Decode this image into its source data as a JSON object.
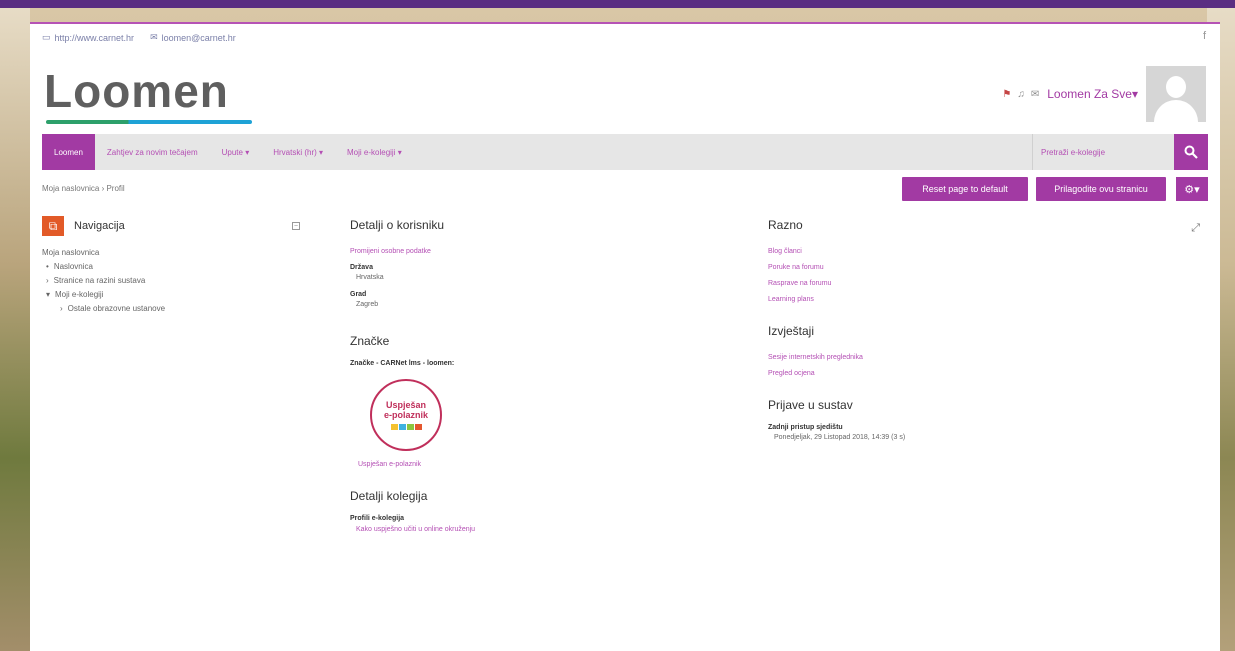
{
  "header": {
    "url": "http://www.carnet.hr",
    "email": "loomen@carnet.hr",
    "social": "f",
    "logo": "Loomen",
    "username": "Loomen Za Sve",
    "username_caret": "▾"
  },
  "nav": {
    "items": [
      {
        "label": "Loomen",
        "active": true
      },
      {
        "label": "Zahtjev za novim tečajem"
      },
      {
        "label": "Upute ▾"
      },
      {
        "label": "Hrvatski (hr) ▾"
      },
      {
        "label": "Moji e-kolegiji ▾"
      }
    ],
    "search_placeholder": "Pretraži e-kolegije",
    "search_icon": "search-icon"
  },
  "breadcrumb": "Moja naslovnica › Profil",
  "buttons": {
    "reset": "Reset page to default",
    "customize": "Prilagodite ovu stranicu"
  },
  "navigation_block": {
    "title": "Navigacija",
    "items": [
      {
        "label": "Moja naslovnica",
        "prefix": ""
      },
      {
        "label": "Naslovnica",
        "prefix": "•"
      },
      {
        "label": "Stranice na razini sustava",
        "prefix": "›"
      },
      {
        "label": "Moji e-kolegiji",
        "prefix": "▾"
      },
      {
        "label": "Ostale obrazovne ustanove",
        "prefix": "›"
      }
    ]
  },
  "user_details": {
    "title": "Detalji o korisniku",
    "edit_link": "Promijeni osobne podatke",
    "country_label": "Država",
    "country_value": "Hrvatska",
    "city_label": "Grad",
    "city_value": "Zagreb"
  },
  "badges": {
    "title": "Značke",
    "source_label": "Značke - CARNet lms - loomen:",
    "badge_text_1": "Uspješan",
    "badge_text_2": "e-polaznik",
    "badge_link": "Uspješan e-polaznik"
  },
  "course_details": {
    "title": "Detalji kolegija",
    "profiles_label": "Profili e-kolegija",
    "course_link": "Kako uspješno učiti u online okruženju"
  },
  "misc": {
    "title": "Razno",
    "links": [
      "Blog članci",
      "Poruke na forumu",
      "Rasprave na forumu",
      "Learning plans"
    ]
  },
  "reports": {
    "title": "Izvještaji",
    "links": [
      "Sesije internetskih preglednika",
      "Pregled ocjena"
    ]
  },
  "logins": {
    "title": "Prijave u sustav",
    "last_access_label": "Zadnji pristup sjedištu",
    "last_access_value": "Ponedjeljak, 29 Listopad 2018, 14:39  (3 s)"
  },
  "colors": {
    "accent": "#a23aa3",
    "nav_bg": "#e6e6e6",
    "block_icon": "#e25a28"
  }
}
